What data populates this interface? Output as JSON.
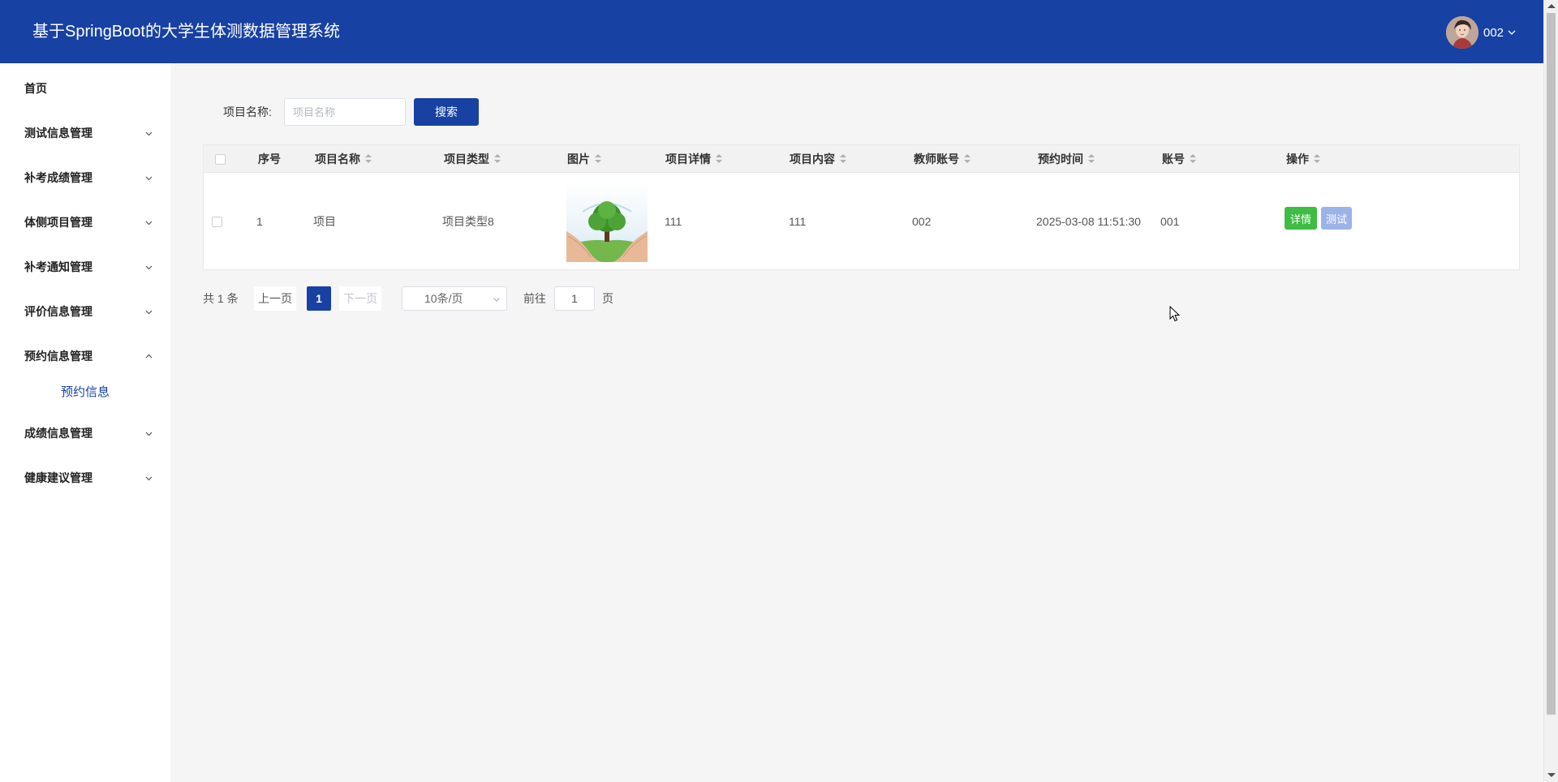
{
  "header": {
    "title": "基于SpringBoot的大学生体测数据管理系统",
    "username": "002"
  },
  "sidebar": {
    "items": [
      {
        "label": "首页",
        "has_arrow": false
      },
      {
        "label": "测试信息管理",
        "has_arrow": true
      },
      {
        "label": "补考成绩管理",
        "has_arrow": true
      },
      {
        "label": "体侧项目管理",
        "has_arrow": true
      },
      {
        "label": "补考通知管理",
        "has_arrow": true
      },
      {
        "label": "评价信息管理",
        "has_arrow": true
      },
      {
        "label": "预约信息管理",
        "has_arrow": true,
        "expanded": true,
        "subitems": [
          {
            "label": "预约信息"
          }
        ]
      },
      {
        "label": "成绩信息管理",
        "has_arrow": true
      },
      {
        "label": "健康建议管理",
        "has_arrow": true
      }
    ]
  },
  "search": {
    "label": "项目名称:",
    "placeholder": "项目名称",
    "value": "",
    "button_label": "搜索"
  },
  "table": {
    "columns": [
      "序号",
      "项目名称",
      "项目类型",
      "图片",
      "项目详情",
      "项目内容",
      "教师账号",
      "预约时间",
      "账号",
      "操作"
    ],
    "rows": [
      {
        "index": "1",
        "name": "项目",
        "type": "项目类型8",
        "image": "tree-in-hands-image",
        "detail": "111",
        "content": "111",
        "teacher_account": "002",
        "time": "2025-03-08 11:51:30",
        "account": "001",
        "actions": [
          "详情",
          "测试"
        ]
      }
    ]
  },
  "pagination": {
    "total_text": "共 1 条",
    "prev_label": "上一页",
    "current_page": "1",
    "next_label": "下一页",
    "page_size": "10条/页",
    "goto_label": "前往",
    "goto_value": "1",
    "page_suffix": "页"
  },
  "colors": {
    "primary": "#1841a4",
    "success": "#3ebc44",
    "test_button": "#9cb3ea"
  }
}
